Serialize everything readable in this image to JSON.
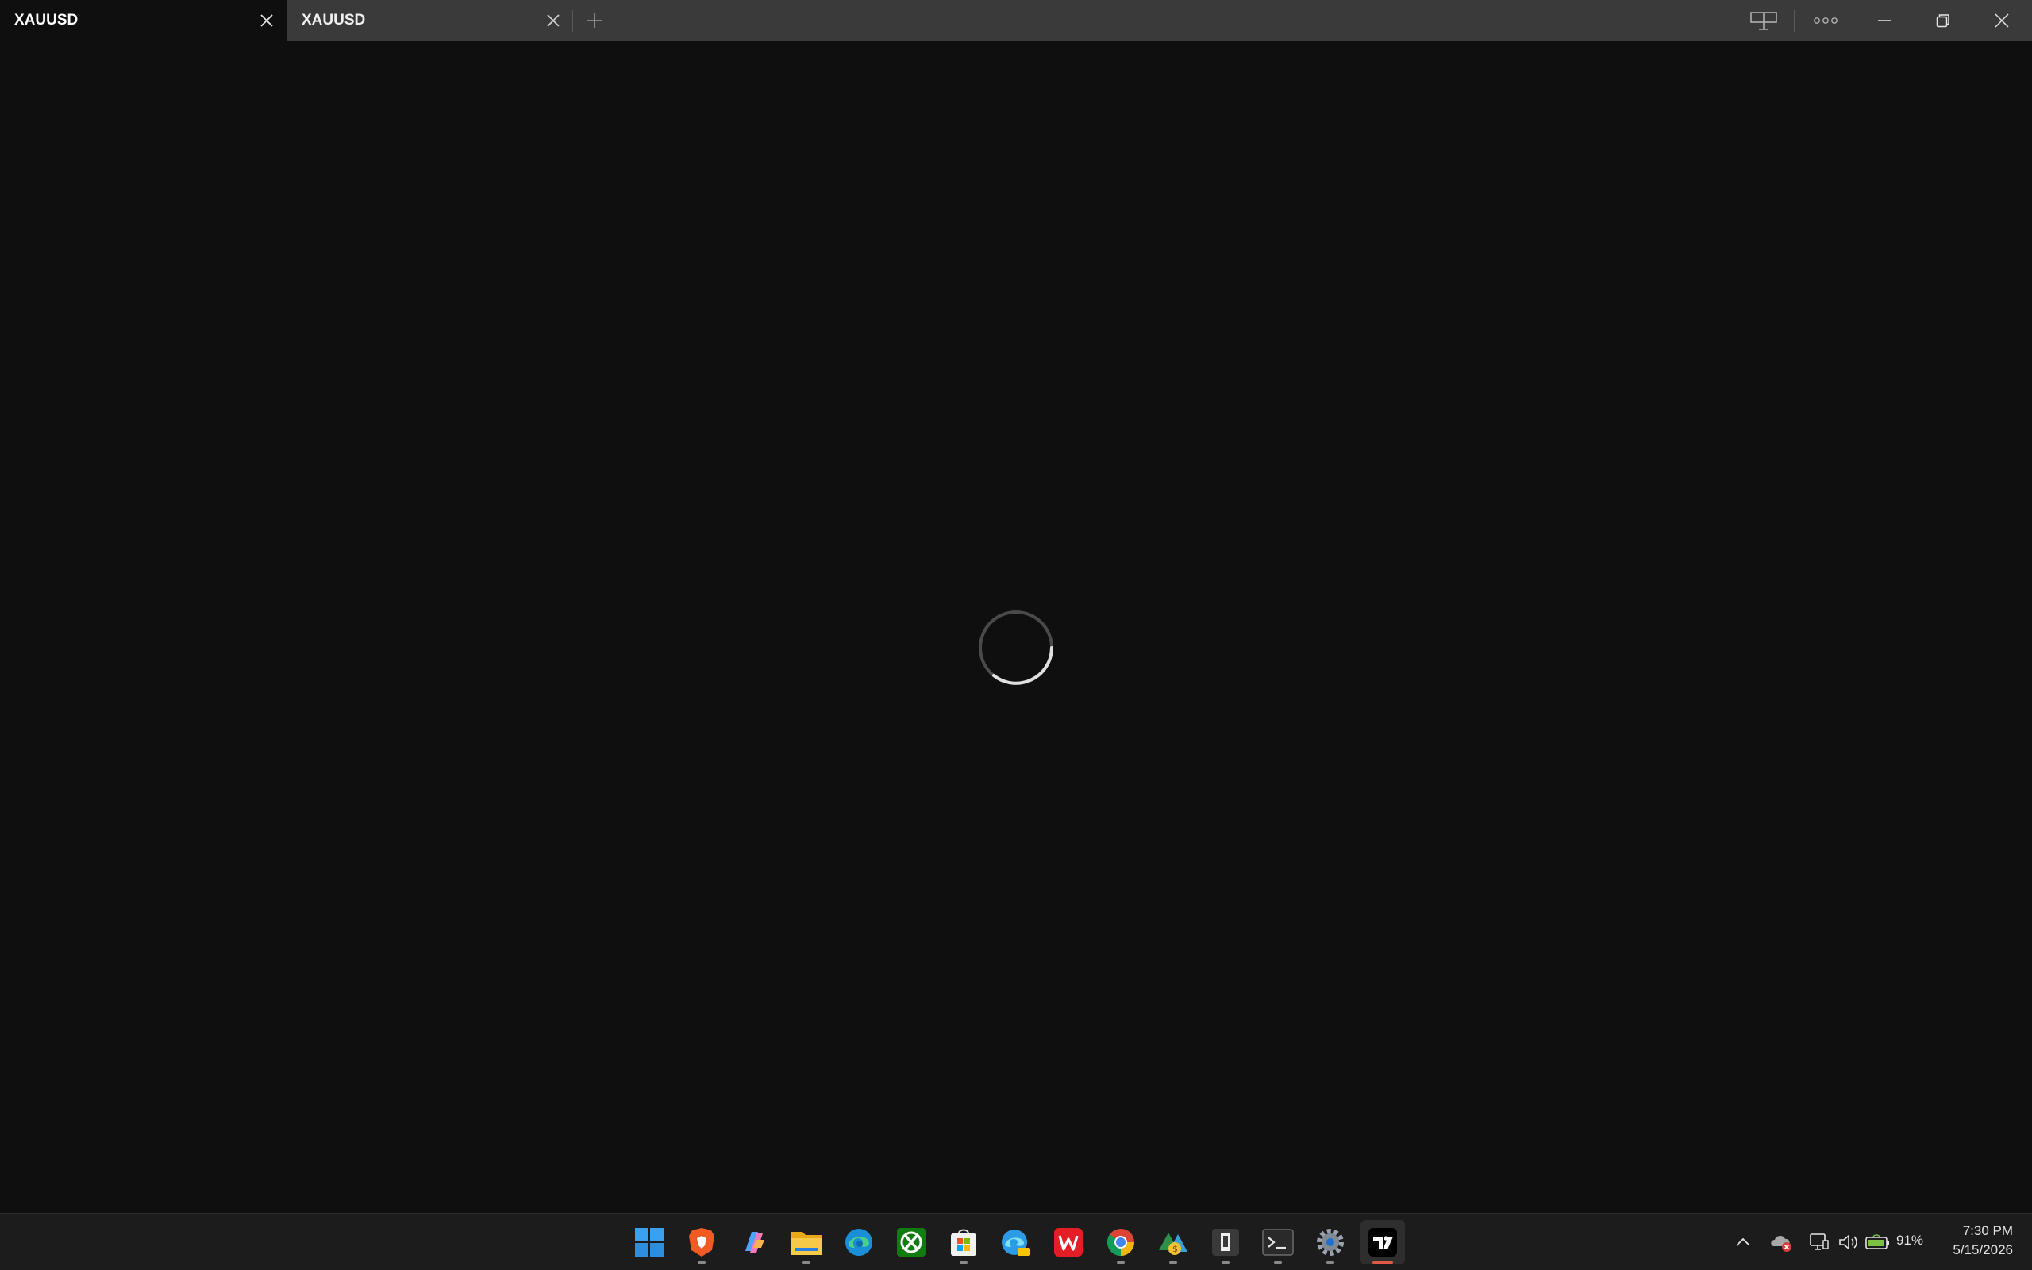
{
  "tabs": [
    {
      "title": "XAUUSD",
      "active": true
    },
    {
      "title": "XAUUSD",
      "active": false
    }
  ],
  "window_controls": [
    "split-view-icon",
    "more-options-icon",
    "minimize-icon",
    "restore-icon",
    "close-icon"
  ],
  "content": {
    "state": "loading"
  },
  "taskbar": {
    "apps": [
      {
        "name": "start-button",
        "running": false
      },
      {
        "name": "brave-browser",
        "running": true
      },
      {
        "name": "copilot",
        "running": false
      },
      {
        "name": "file-explorer",
        "running": true
      },
      {
        "name": "edge-browser",
        "running": false
      },
      {
        "name": "xbox",
        "running": false
      },
      {
        "name": "microsoft-store",
        "running": true
      },
      {
        "name": "edge-beta",
        "running": false
      },
      {
        "name": "wps-office",
        "running": false
      },
      {
        "name": "chrome-browser",
        "running": true
      },
      {
        "name": "metatrader",
        "running": true
      },
      {
        "name": "dark-app",
        "running": true
      },
      {
        "name": "terminal",
        "running": true
      },
      {
        "name": "settings",
        "running": true
      },
      {
        "name": "tradingview",
        "running": true,
        "active": true
      }
    ],
    "tray": {
      "battery_percent": "91%",
      "time": "7:30 PM",
      "date": "5/15/2026"
    }
  },
  "colors": {
    "background": "#0f0f0f",
    "titlebar": "#3a3a3a",
    "taskbar": "#1c1c1c",
    "active_indicator": "#e05a47"
  }
}
